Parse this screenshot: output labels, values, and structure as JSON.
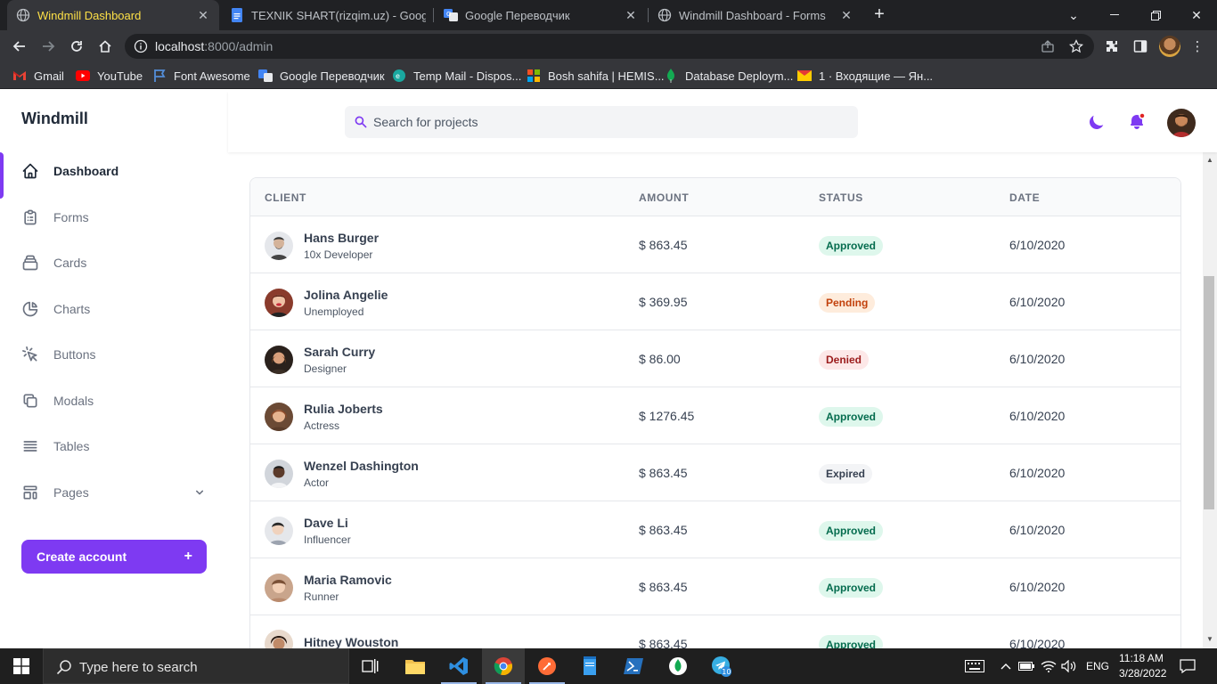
{
  "browser": {
    "tabs": [
      {
        "title": "Windmill Dashboard",
        "active": true
      },
      {
        "title": "TEXNIK SHART(rizqim.uz) - Goog",
        "active": false
      },
      {
        "title": "Google Переводчик",
        "active": false
      },
      {
        "title": "Windmill Dashboard - Forms",
        "active": false
      }
    ],
    "url_host": "localhost",
    "url_path": ":8000/admin",
    "bookmarks": [
      {
        "label": "Gmail",
        "icon": "gmail-icon"
      },
      {
        "label": "YouTube",
        "icon": "youtube-icon"
      },
      {
        "label": "Font Awesome",
        "icon": "font-awesome-icon"
      },
      {
        "label": "Google Переводчик",
        "icon": "google-translate-icon"
      },
      {
        "label": "Temp Mail - Dispos...",
        "icon": "temp-mail-icon"
      },
      {
        "label": "Bosh sahifa | HEMIS...",
        "icon": "hemis-icon"
      },
      {
        "label": "Database Deploym...",
        "icon": "mongodb-icon"
      },
      {
        "label": "1 · Входящие — Ян...",
        "icon": "yandex-mail-icon"
      }
    ]
  },
  "app": {
    "brand": "Windmill",
    "nav": [
      {
        "label": "Dashboard",
        "icon": "home-icon",
        "active": true
      },
      {
        "label": "Forms",
        "icon": "clipboard-icon",
        "active": false
      },
      {
        "label": "Cards",
        "icon": "cards-icon",
        "active": false
      },
      {
        "label": "Charts",
        "icon": "pie-chart-icon",
        "active": false
      },
      {
        "label": "Buttons",
        "icon": "cursor-click-icon",
        "active": false
      },
      {
        "label": "Modals",
        "icon": "modals-icon",
        "active": false
      },
      {
        "label": "Tables",
        "icon": "tables-icon",
        "active": false
      },
      {
        "label": "Pages",
        "icon": "pages-icon",
        "active": false
      }
    ],
    "create_account": "Create account",
    "create_plus": "+",
    "search_placeholder": "Search for projects",
    "accent": "#7e3af2",
    "table": {
      "headers": [
        "CLIENT",
        "AMOUNT",
        "STATUS",
        "DATE"
      ],
      "rows": [
        {
          "name": "Hans Burger",
          "role": "10x Developer",
          "amount": "$ 863.45",
          "status": "Approved",
          "date": "6/10/2020"
        },
        {
          "name": "Jolina Angelie",
          "role": "Unemployed",
          "amount": "$ 369.95",
          "status": "Pending",
          "date": "6/10/2020"
        },
        {
          "name": "Sarah Curry",
          "role": "Designer",
          "amount": "$ 86.00",
          "status": "Denied",
          "date": "6/10/2020"
        },
        {
          "name": "Rulia Joberts",
          "role": "Actress",
          "amount": "$ 1276.45",
          "status": "Approved",
          "date": "6/10/2020"
        },
        {
          "name": "Wenzel Dashington",
          "role": "Actor",
          "amount": "$ 863.45",
          "status": "Expired",
          "date": "6/10/2020"
        },
        {
          "name": "Dave Li",
          "role": "Influencer",
          "amount": "$ 863.45",
          "status": "Approved",
          "date": "6/10/2020"
        },
        {
          "name": "Maria Ramovic",
          "role": "Runner",
          "amount": "$ 863.45",
          "status": "Approved",
          "date": "6/10/2020"
        },
        {
          "name": "Hitney Wouston",
          "role": "",
          "amount": "$ 863.45",
          "status": "Approved",
          "date": "6/10/2020"
        }
      ]
    },
    "status_colors": {
      "Approved": {
        "bg": "#def7ec",
        "fg": "#046c4e"
      },
      "Pending": {
        "bg": "#feecdc",
        "fg": "#c2410c"
      },
      "Denied": {
        "bg": "#fde8e8",
        "fg": "#9b1c1c"
      },
      "Expired": {
        "bg": "#f3f4f6",
        "fg": "#374151"
      }
    }
  },
  "taskbar": {
    "search_text": "Type here to search",
    "apps": [
      "task-view-icon",
      "file-explorer-icon",
      "vscode-icon",
      "chrome-icon",
      "postman-icon",
      "notepad-icon",
      "powershell-icon",
      "mongodb-compass-icon",
      "telegram-icon"
    ],
    "telegram_badge": "10",
    "language": "ENG",
    "time": "11:18 AM",
    "date": "3/28/2022"
  }
}
